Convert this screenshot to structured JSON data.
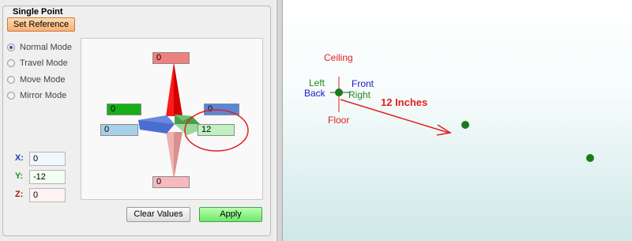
{
  "panel": {
    "title": "Single Point",
    "set_reference_label": "Set Reference",
    "modes": [
      {
        "label": "Normal Mode",
        "selected": true
      },
      {
        "label": "Travel Mode",
        "selected": false
      },
      {
        "label": "Move Mode",
        "selected": false
      },
      {
        "label": "Mirror Mode",
        "selected": false
      }
    ],
    "coords": {
      "x_label": "X:",
      "x_value": "0",
      "x_color": "#1a3fb8",
      "y_label": "Y:",
      "y_value": "-12",
      "y_color": "#1f8a1f",
      "z_label": "Z:",
      "z_value": "0",
      "z_color": "#b01818"
    },
    "gizmo": {
      "top_value": "0",
      "left_green_value": "0",
      "right_blue_value": "0",
      "left_lightblue_value": "0",
      "front_value": "12",
      "bottom_value": "0"
    },
    "clear_label": "Clear Values",
    "apply_label": "Apply"
  },
  "viewport": {
    "ceiling_label": "Ceiling",
    "left_label": "Left",
    "front_label": "Front",
    "back_label": "Back",
    "right_label": "Right",
    "floor_label": "Floor",
    "distance_label": "12 Inches",
    "colors": {
      "ceiling": "#e02020",
      "left": "#1f8a1f",
      "front": "#1a1acc",
      "annot": "#e02020",
      "point": "#1a7a1a"
    }
  }
}
